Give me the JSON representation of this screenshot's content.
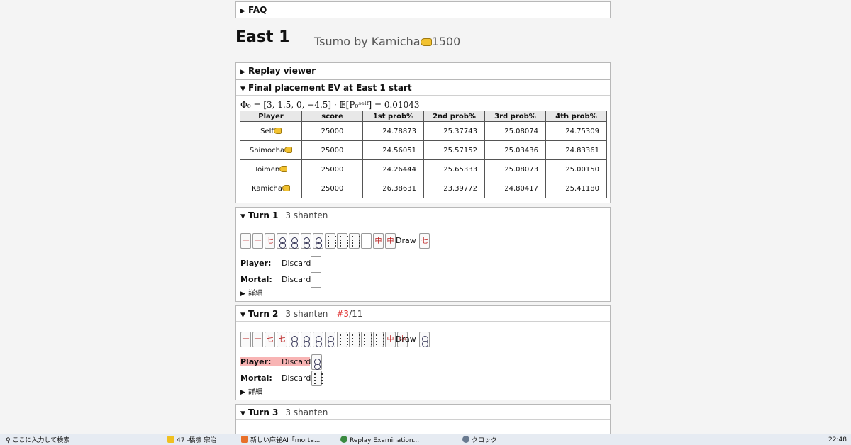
{
  "faq": {
    "label": "FAQ"
  },
  "header": {
    "title": "East 1",
    "tsumo_by": "Tsumo by Kamicha",
    "tsumo_points": "1500"
  },
  "sections": {
    "replay": "Replay viewer",
    "placement": "Final placement EV at East 1 start"
  },
  "formula": "Φ₀ = [3, 1.5, 0, −4.5] · 𝔼[P₀ˢᵉˡᶠ] = 0.01043",
  "table": {
    "headers": [
      "Player",
      "score",
      "1st prob%",
      "2nd prob%",
      "3rd prob%",
      "4th prob%"
    ],
    "rows": [
      {
        "player": "Self",
        "score": "25000",
        "p1": "24.78873",
        "p2": "25.37743",
        "p3": "25.08074",
        "p4": "24.75309"
      },
      {
        "player": "Shimocha",
        "score": "25000",
        "p1": "24.56051",
        "p2": "25.57152",
        "p3": "25.03436",
        "p4": "24.83361"
      },
      {
        "player": "Toimen",
        "score": "25000",
        "p1": "24.26444",
        "p2": "25.65333",
        "p3": "25.08073",
        "p4": "25.00150"
      },
      {
        "player": "Kamicha",
        "score": "25000",
        "p1": "26.38631",
        "p2": "23.39772",
        "p3": "24.80417",
        "p4": "25.41180"
      }
    ]
  },
  "turns": [
    {
      "title": "Turn 1",
      "shanten": "3 shanten",
      "rank": "",
      "rank_total": "",
      "draw": "Draw",
      "player": "Player:",
      "mortal": "Mortal:",
      "discard": "Discard",
      "details": "詳細"
    },
    {
      "title": "Turn 2",
      "shanten": "3 shanten",
      "rank": "#3",
      "rank_total": "/11",
      "draw": "Draw",
      "player": "Player:",
      "mortal": "Mortal:",
      "discard": "Discard",
      "details": "詳細"
    },
    {
      "title": "Turn 3",
      "shanten": "3 shanten"
    }
  ],
  "taskbar": {
    "search": "ここに入力して検索",
    "item1": "47 -橋凛 宗治",
    "item2": "新しい麻雀AI「morta...",
    "item3": "Replay Examination...",
    "item4": "クロック",
    "time": "22:48"
  }
}
